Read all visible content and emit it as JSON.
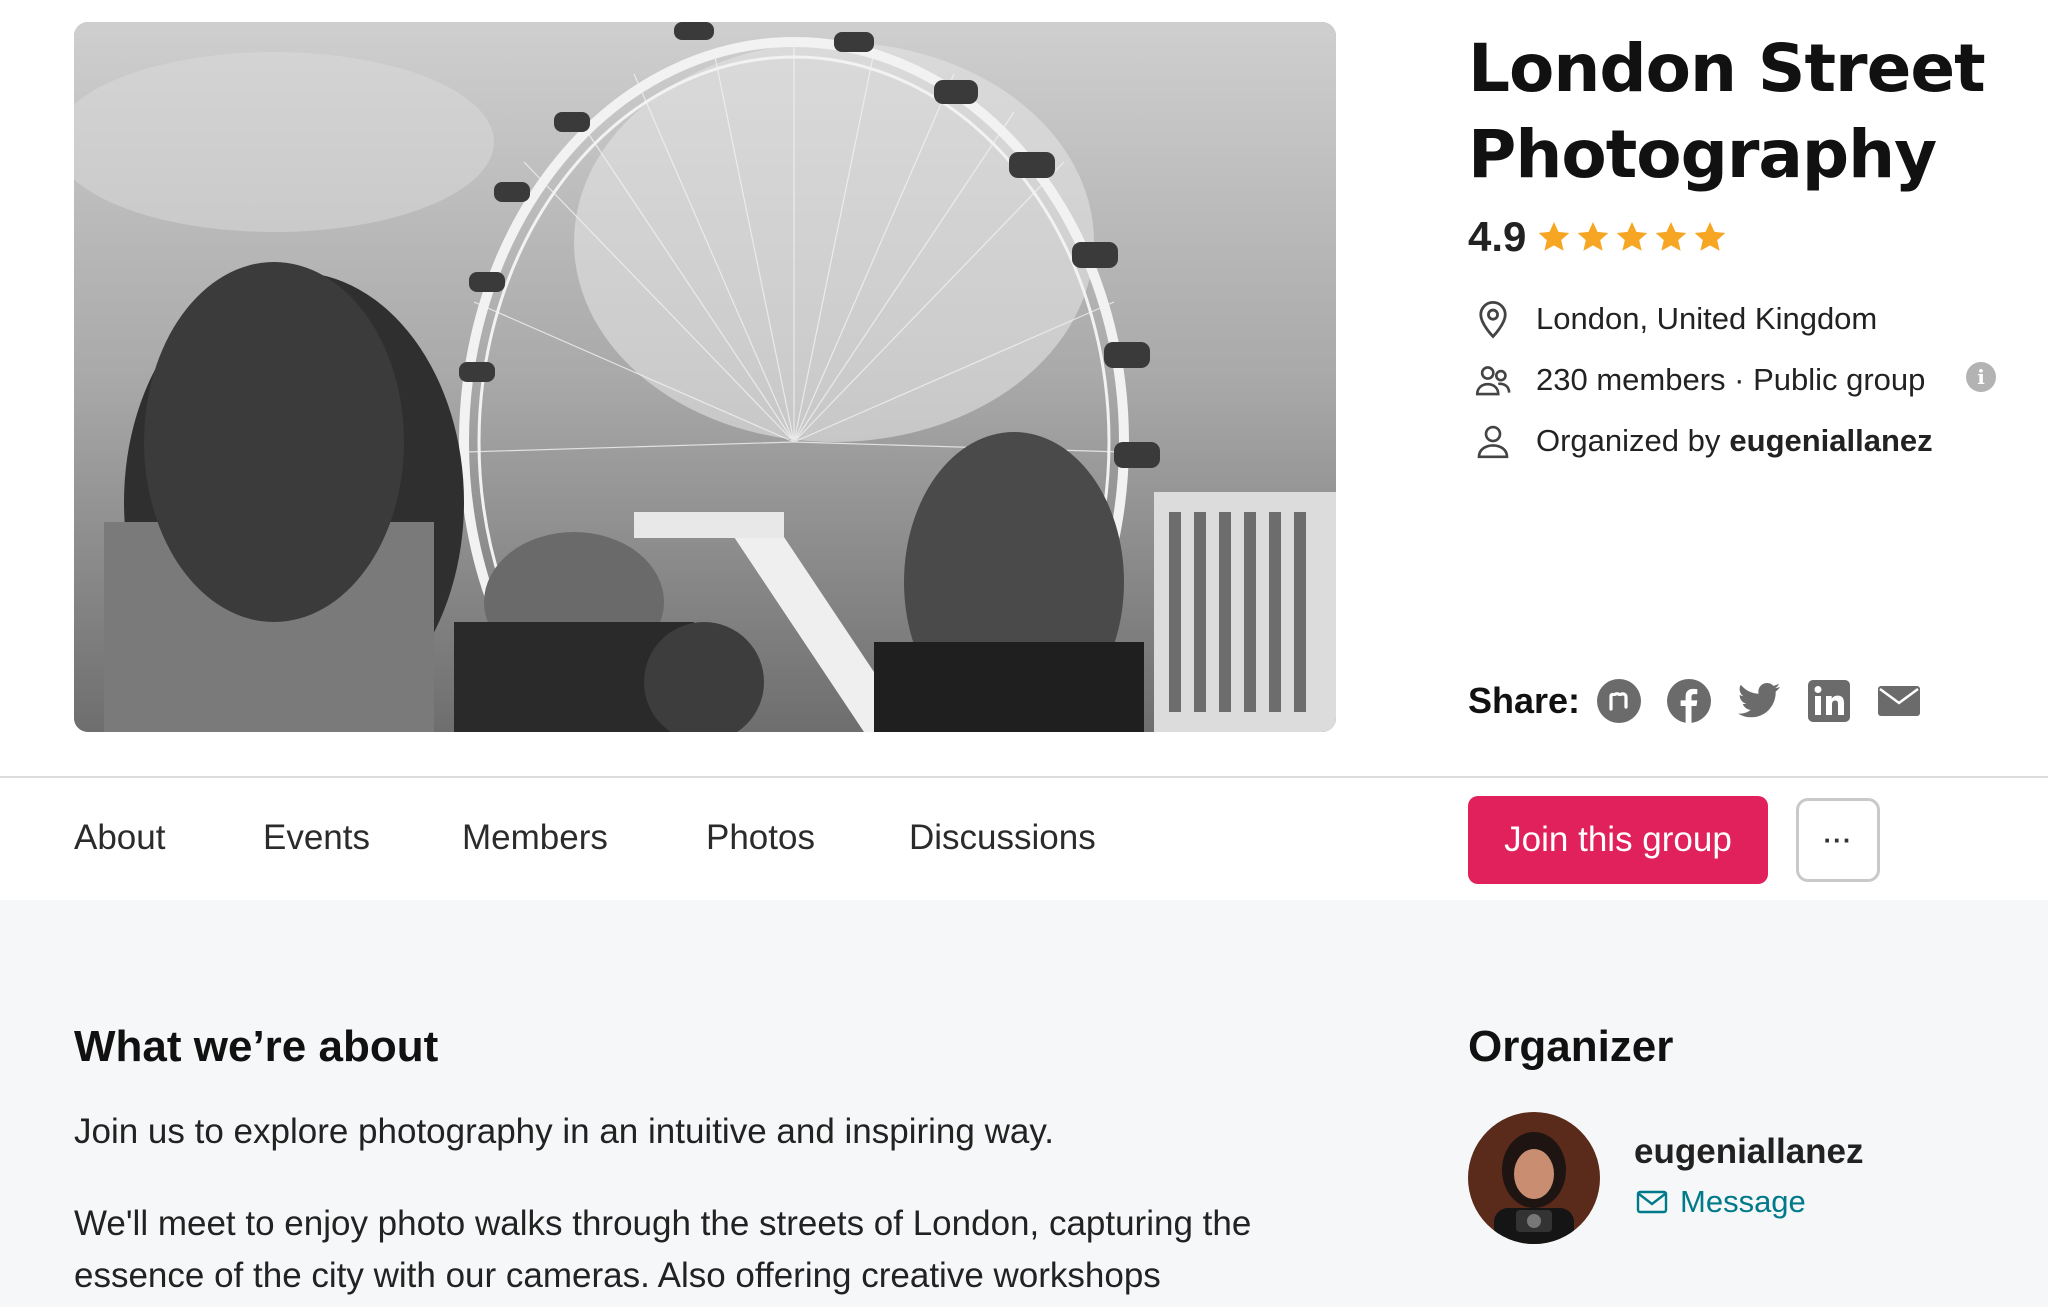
{
  "group": {
    "title": "London Street Photography",
    "rating": "4.9",
    "rating_stars": 5,
    "location": "London, United Kingdom",
    "members_text": "230 members · Public group",
    "organized_by_prefix": "Organized by",
    "organizer_handle": "eugeniallanez"
  },
  "share": {
    "label": "Share:",
    "icons": [
      "meetup-icon",
      "facebook-icon",
      "twitter-icon",
      "linkedin-icon",
      "email-icon"
    ]
  },
  "tabs": [
    {
      "label": "About"
    },
    {
      "label": "Events"
    },
    {
      "label": "Members"
    },
    {
      "label": "Photos"
    },
    {
      "label": "Discussions"
    }
  ],
  "actions": {
    "join_label": "Join this group",
    "more_label": "···"
  },
  "about": {
    "heading": "What we’re about",
    "paragraph1": "Join us to explore photography in an intuitive and inspiring way.",
    "paragraph2": "We'll meet to enjoy photo walks through the streets of London, capturing the essence of the city with our cameras. Also offering creative workshops"
  },
  "organizer": {
    "heading": "Organizer",
    "name": "eugeniallanez",
    "message_label": "Message"
  },
  "colors": {
    "brand_accent": "#e0215b",
    "star": "#f6a623",
    "link": "#00798a",
    "content_bg": "#f6f7f8"
  }
}
